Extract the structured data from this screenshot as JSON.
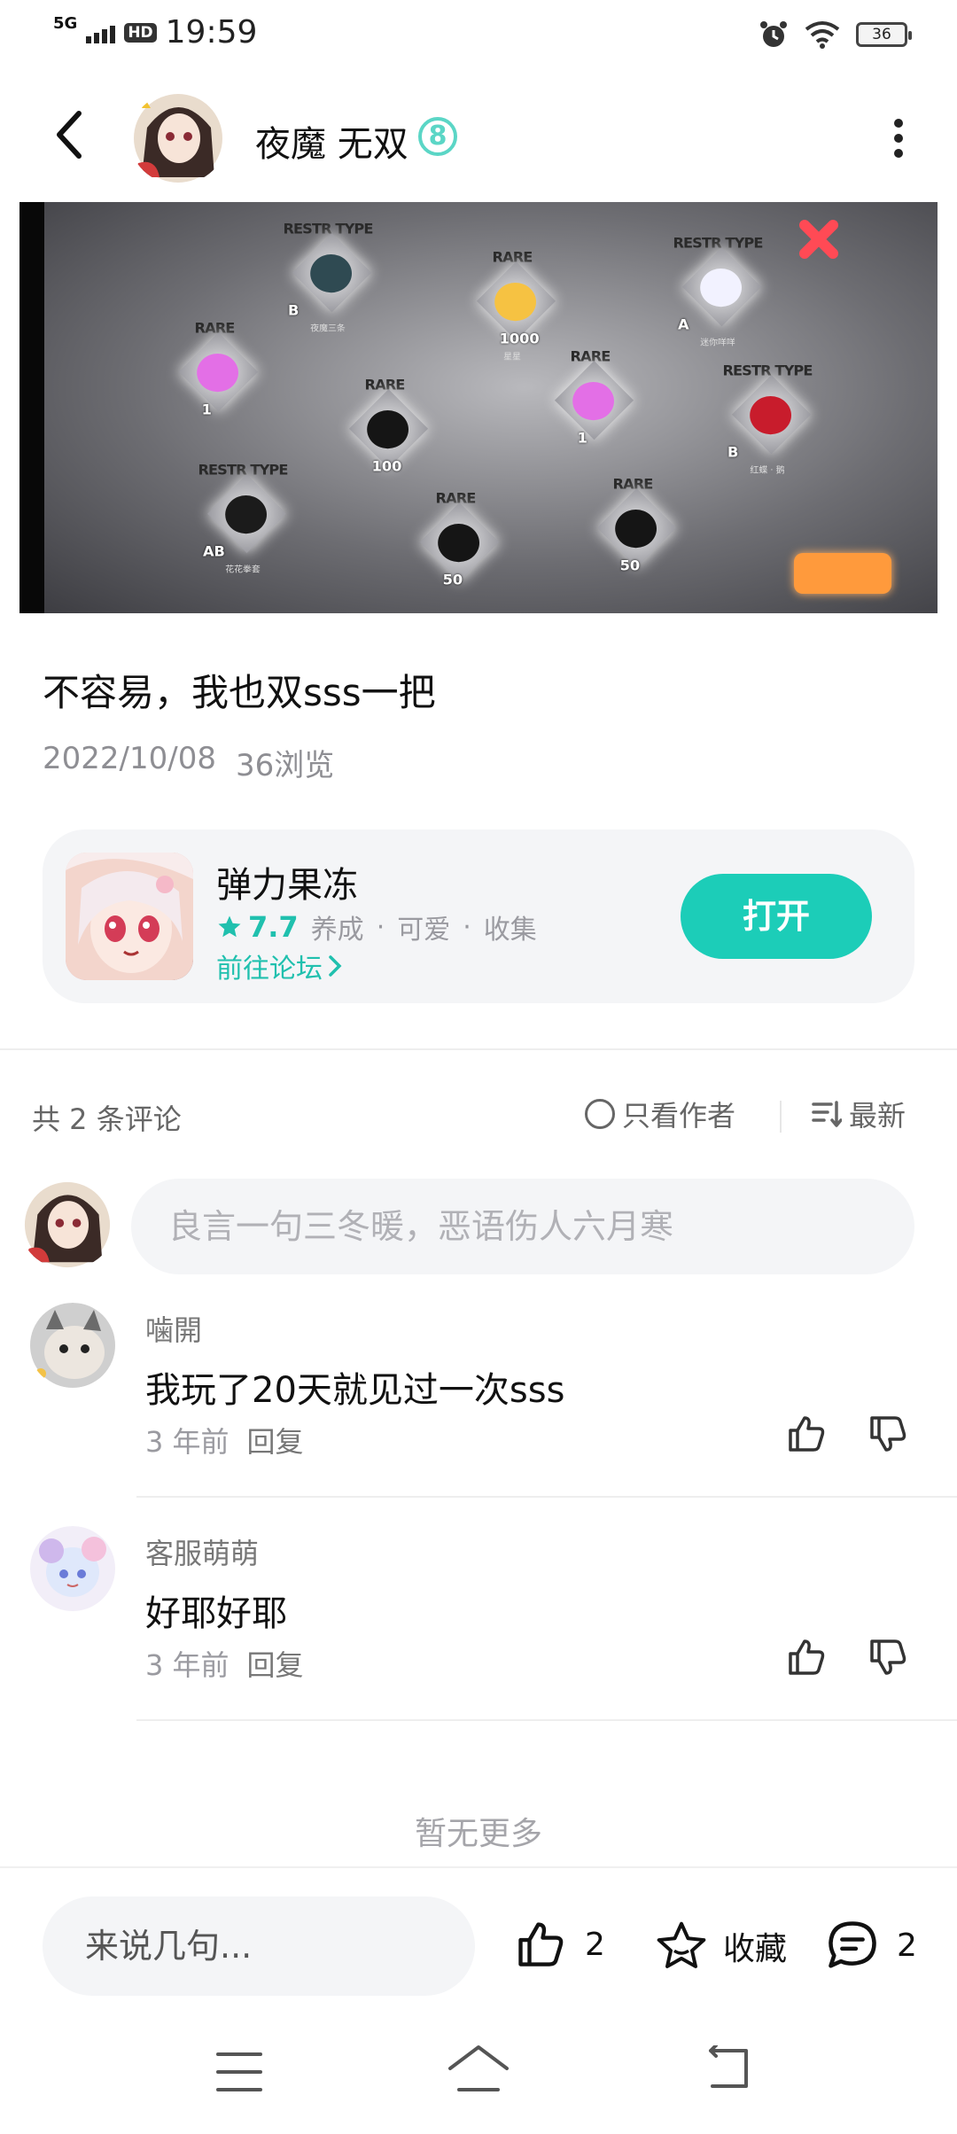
{
  "status_bar": {
    "network": "5G",
    "hd": "HD",
    "time": "19:59",
    "battery": "36",
    "icons": [
      "signal-icon",
      "alarm-icon",
      "wifi-icon",
      "battery-icon"
    ]
  },
  "header": {
    "author_name": "夜魔 无双",
    "level": "8",
    "icons": [
      "back-arrow-icon",
      "more-vertical-icon"
    ]
  },
  "post_image": {
    "items": [
      {
        "tag": "RESTR TYPE",
        "num": "",
        "cap": "夜魔三条",
        "grade": "B"
      },
      {
        "tag": "RARE",
        "num": "1000",
        "cap": "星星",
        "grade": ""
      },
      {
        "tag": "RESTR TYPE",
        "num": "",
        "cap": "迷你咩咩",
        "grade": "A"
      },
      {
        "tag": "RARE",
        "num": "1",
        "cap": "",
        "grade": ""
      },
      {
        "tag": "RARE",
        "num": "100",
        "cap": "",
        "grade": ""
      },
      {
        "tag": "RARE",
        "num": "1",
        "cap": "",
        "grade": ""
      },
      {
        "tag": "RESTR TYPE",
        "num": "",
        "cap": "红蝶 · 鹅",
        "grade": "B"
      },
      {
        "tag": "RESTR TYPE",
        "num": "",
        "cap": "花花拳套",
        "grade": "AB"
      },
      {
        "tag": "RARE",
        "num": "50",
        "cap": "",
        "grade": ""
      },
      {
        "tag": "RARE",
        "num": "50",
        "cap": "",
        "grade": ""
      }
    ]
  },
  "post": {
    "title": "不容易，我也双sss一把",
    "date": "2022/10/08",
    "views": "36浏览"
  },
  "game_card": {
    "name": "弹力果冻",
    "rating": "7.7",
    "tags": [
      "养成",
      "可爱",
      "收集"
    ],
    "tag_separator": "·",
    "forum_link": "前往论坛",
    "open_label": "打开",
    "accent_color": "#1ccdb8"
  },
  "comments_bar": {
    "count_label": "共 2 条评论",
    "author_only_label": "只看作者",
    "sort_label": "最新"
  },
  "reply": {
    "placeholder": "良言一句三冬暖，恶语伤人六月寒"
  },
  "comments": [
    {
      "name": "噛開",
      "text": "我玩了20天就见过一次sss",
      "time": "3 年前",
      "reply_label": "回复"
    },
    {
      "name": "客服萌萌",
      "text": "好耶好耶",
      "time": "3 年前",
      "reply_label": "回复"
    }
  ],
  "list_end": "暂无更多",
  "bottom_bar": {
    "input_placeholder": "来说几句...",
    "like_count": "2",
    "favorite_label": "收藏",
    "comment_count": "2"
  },
  "nav": {
    "icons": [
      "menu-icon",
      "home-icon",
      "back-icon"
    ]
  }
}
